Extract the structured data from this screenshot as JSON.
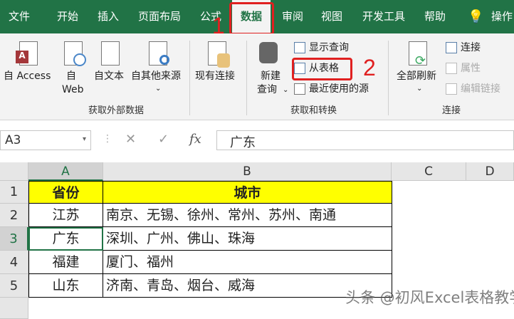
{
  "tabs": [
    "文件",
    "开始",
    "插入",
    "页面布局",
    "公式",
    "数据",
    "审阅",
    "视图",
    "开发工具",
    "帮助",
    "操作"
  ],
  "selected_tab": "数据",
  "ribbon": {
    "get_external": {
      "access": "自 Access",
      "web_line1": "自",
      "web_line2": "Web",
      "text": "自文本",
      "other": "自其他来源",
      "existing": "现有连接",
      "group": "获取外部数据"
    },
    "get_transform": {
      "new_query_line1": "新建",
      "new_query_line2": "查询",
      "show_queries": "显示查询",
      "from_table": "从表格",
      "recent_sources": "最近使用的源",
      "group": "获取和转换"
    },
    "connections": {
      "refresh_all": "全部刷新",
      "connections": "连接",
      "properties": "属性",
      "edit_links": "编辑链接",
      "group": "连接"
    }
  },
  "annotations": {
    "step1": "1",
    "step2": "2"
  },
  "formula_bar": {
    "name_box": "A3",
    "fx": "fx",
    "value": "广东"
  },
  "columns": [
    "A",
    "B",
    "C",
    "D"
  ],
  "rows": [
    {
      "num": "1",
      "a": "省份",
      "b": "城市"
    },
    {
      "num": "2",
      "a": "江苏",
      "b": "南京、无锡、徐州、常州、苏州、南通"
    },
    {
      "num": "3",
      "a": "广东",
      "b": "深圳、广州、佛山、珠海"
    },
    {
      "num": "4",
      "a": "福建",
      "b": "厦门、福州"
    },
    {
      "num": "5",
      "a": "山东",
      "b": "济南、青岛、烟台、威海"
    }
  ],
  "watermark": "头条 @初风Excel表格教学",
  "colors": {
    "excel_green": "#217346",
    "header_fill": "#ffff00",
    "annotation_red": "#e02020"
  }
}
